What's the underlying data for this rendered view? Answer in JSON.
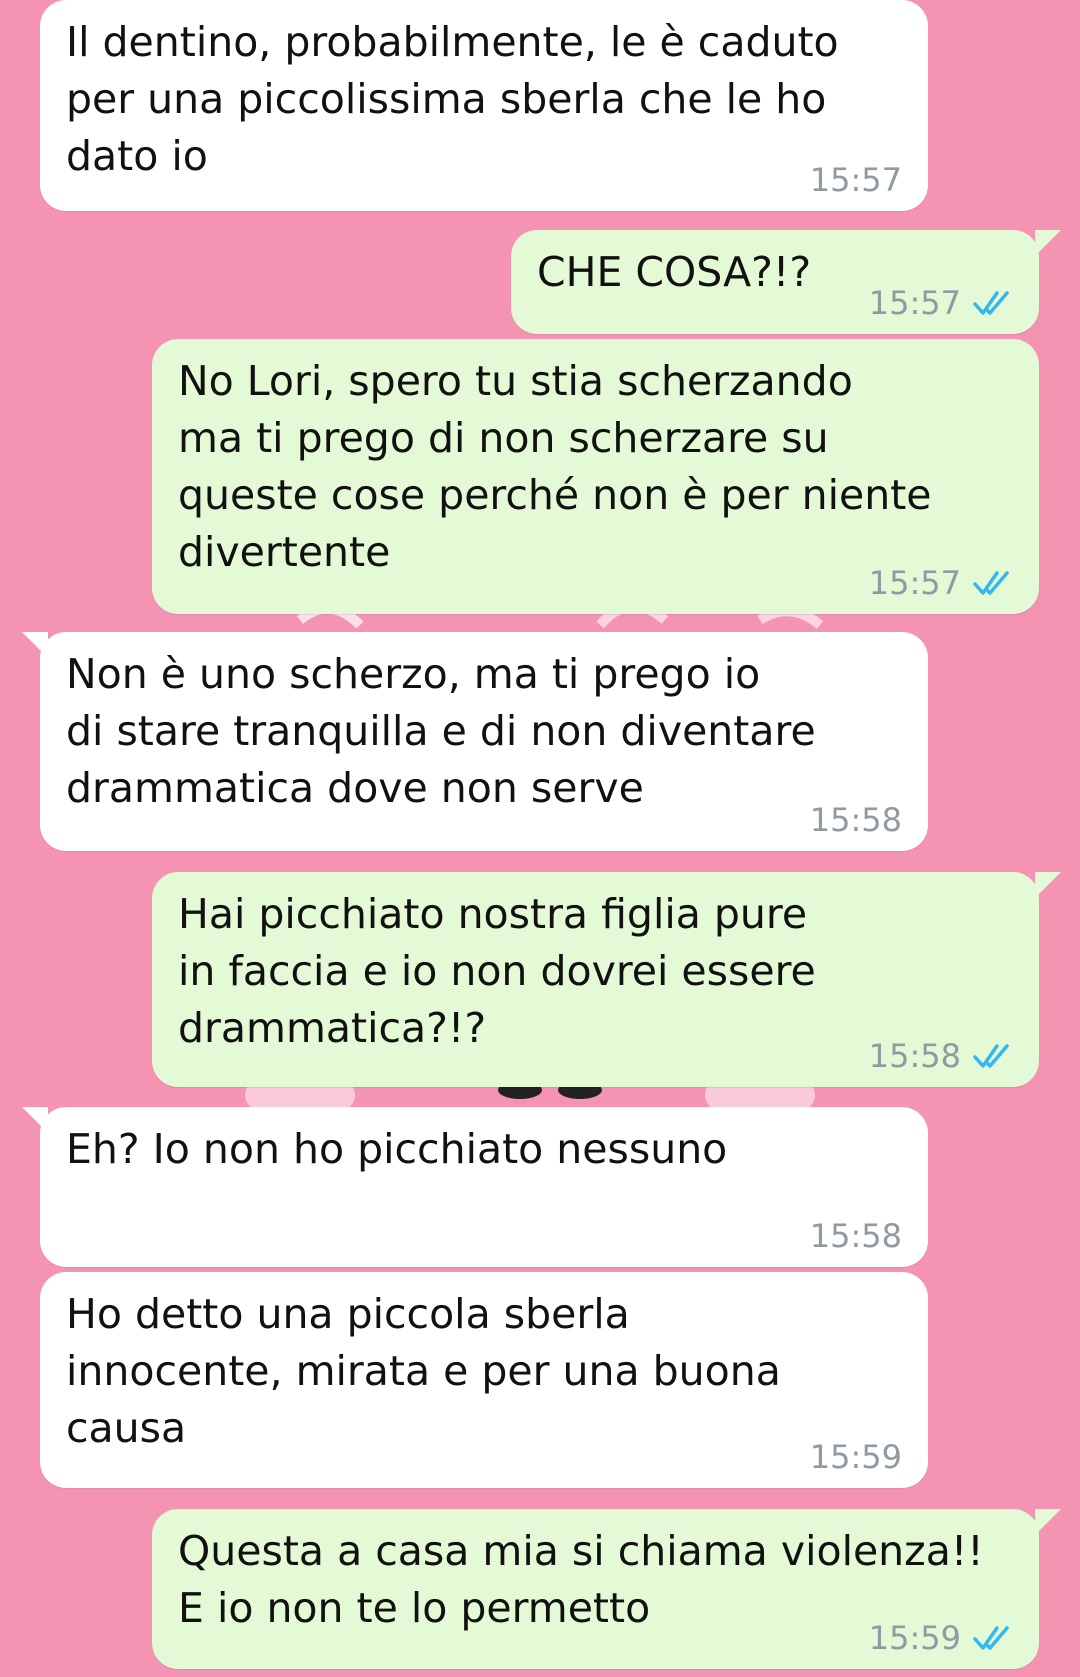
{
  "messages": [
    {
      "id": 1,
      "direction": "incoming",
      "text": "Il dentino, probabilmente, le è caduto\nper una piccolissima sberla che le ho\ndato io",
      "time": "15:57",
      "tail": false
    },
    {
      "id": 2,
      "direction": "outgoing",
      "text": "CHE COSA?!?",
      "time": "15:57",
      "read": true,
      "tail": true
    },
    {
      "id": 3,
      "direction": "outgoing",
      "text": "No Lori, spero tu stia scherzando\nma ti prego di non scherzare su\nqueste cose perché non è per niente\ndivertente",
      "time": "15:57",
      "read": true,
      "tail": false
    },
    {
      "id": 4,
      "direction": "incoming",
      "text": "Non è uno scherzo, ma ti prego io\ndi stare tranquilla e di non diventare\ndrammatica dove non serve",
      "time": "15:58",
      "tail": true
    },
    {
      "id": 5,
      "direction": "outgoing",
      "text": "Hai picchiato nostra figlia pure\nin faccia e io non dovrei essere\ndrammatica?!?",
      "time": "15:58",
      "read": true,
      "tail": true
    },
    {
      "id": 6,
      "direction": "incoming",
      "text": "Eh? Io non ho picchiato nessuno",
      "time": "15:58",
      "tail": true
    },
    {
      "id": 7,
      "direction": "incoming",
      "text": "Ho detto una piccola sberla\ninnocente, mirata e per una buona\ncausa",
      "time": "15:59",
      "tail": false
    },
    {
      "id": 8,
      "direction": "outgoing",
      "text": "Questa a casa mia si chiama violenza!!\nE io non te lo permetto",
      "time": "15:59",
      "read": true,
      "tail": true
    }
  ],
  "colors": {
    "wallpaper": "#f494b2",
    "incoming_bubble": "#ffffff",
    "outgoing_bubble": "#e4f9d6",
    "timestamp": "#8f9aa3",
    "read_ticks": "#34b7f1"
  },
  "icons": {
    "read_receipt": "double-check-icon"
  }
}
